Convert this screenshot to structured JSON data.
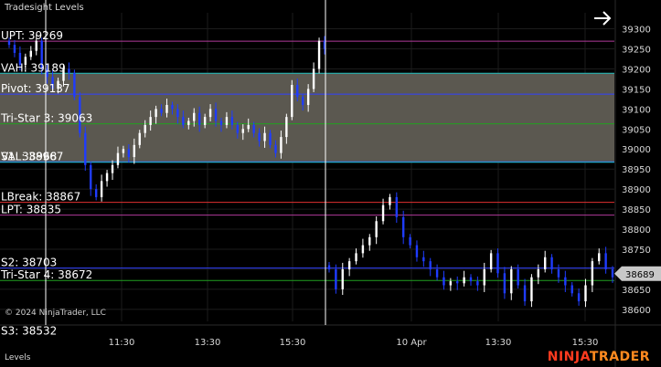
{
  "header": {
    "title": "Tradesight Levels",
    "panel_label": "Levels",
    "copyright": "© 2024 NinjaTrader, LLC",
    "brand_part1": "NINJA",
    "brand_part2": "TRADER"
  },
  "colors": {
    "background": "#000000",
    "value_area_fill": "#5b5850",
    "up_candle": "#ffffff",
    "down_candle": "#1f3cff",
    "vertical_marker": "#ffffff",
    "current_price_tag": "#c8c8c8"
  },
  "chart_data": {
    "type": "candlestick",
    "ylim": [
      38570,
      39340
    ],
    "y_ticks": [
      39300,
      39250,
      39200,
      39150,
      39100,
      39050,
      39000,
      38950,
      38900,
      38850,
      38800,
      38750,
      38700,
      38650,
      38600
    ],
    "x_ticks": [
      "11:30",
      "13:30",
      "15:30",
      "10 Apr",
      "13:30",
      "15:30"
    ],
    "current_price": "38689",
    "value_area": {
      "from": 38967,
      "to": 39189
    },
    "levels": [
      {
        "label": "UPT: 39269",
        "value": 39269,
        "color": "#b03a9a"
      },
      {
        "label": "VAH: 39189",
        "value": 39189,
        "color": "#20c0c0"
      },
      {
        "label": "Pivot: 39137",
        "value": 39137,
        "color": "#3040ff"
      },
      {
        "label": "Tri-Star 3: 39063",
        "value": 39063,
        "color": "#20a020"
      },
      {
        "label": "S1: 38968",
        "value": 38968,
        "color": "#3040ff"
      },
      {
        "label": "VAL: 38967",
        "value": 38967,
        "color": "#20c0c0"
      },
      {
        "label": "LBreak: 38867",
        "value": 38867,
        "color": "#e03030"
      },
      {
        "label": "LPT: 38835",
        "value": 38835,
        "color": "#b03a9a"
      },
      {
        "label": "S2: 38703",
        "value": 38703,
        "color": "#3040ff"
      },
      {
        "label": "Tri-Star 4: 38672",
        "value": 38672,
        "color": "#20a020"
      },
      {
        "label": "S3: 38532",
        "value": 38532,
        "color": "#3040ff"
      }
    ],
    "day_one": [
      39260,
      39240,
      39210,
      39230,
      39245,
      39270,
      39200,
      39180,
      39150,
      39170,
      39200,
      39190,
      39130,
      39040,
      38960,
      38900,
      38880,
      38920,
      38940,
      38960,
      38990,
      39000,
      38980,
      39010,
      39040,
      39060,
      39080,
      39100,
      39090,
      39110,
      39100,
      39080,
      39060,
      39070,
      39090,
      39060,
      39080,
      39100,
      39070,
      39060,
      39080,
      39060,
      39040,
      39050,
      39060,
      39040,
      39020,
      39040,
      39010,
      38990,
      39030,
      39080,
      39160,
      39130,
      39110,
      39150,
      39200,
      39270,
      39250
    ],
    "day_two": [
      38700,
      38650,
      38700,
      38720,
      38740,
      38760,
      38780,
      38820,
      38860,
      38880,
      38830,
      38780,
      38760,
      38730,
      38720,
      38700,
      38680,
      38660,
      38670,
      38665,
      38680,
      38670,
      38660,
      38700,
      38740,
      38690,
      38640,
      38700,
      38660,
      38620,
      38680,
      38700,
      38730,
      38700,
      38680,
      38660,
      38640,
      38620,
      38660,
      38720,
      38740,
      38700,
      38680
    ]
  }
}
